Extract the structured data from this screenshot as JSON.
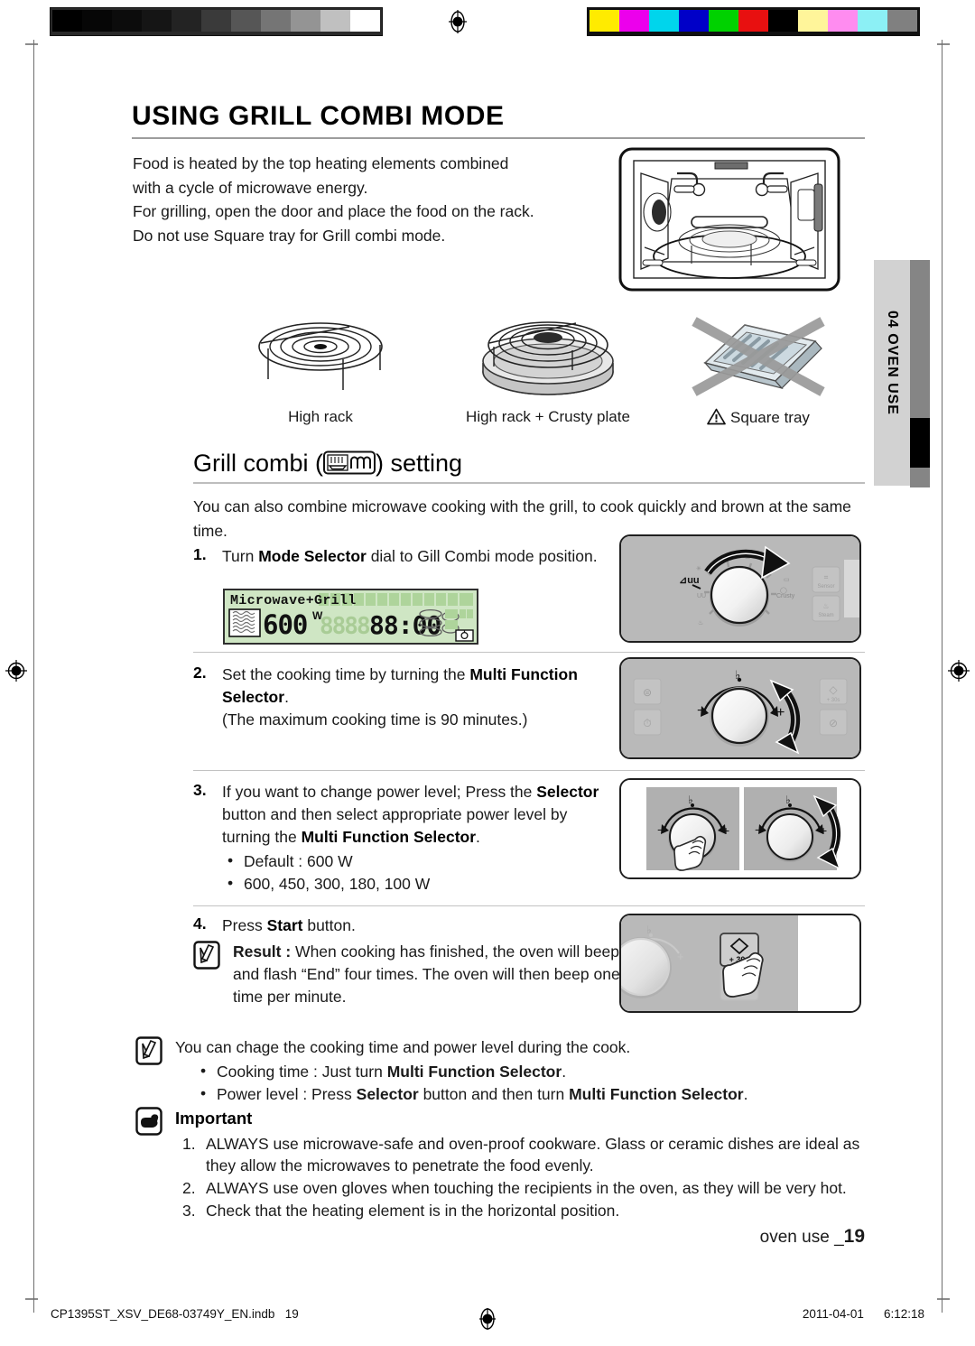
{
  "calibration": {
    "gray_ramp": [
      "#000000",
      "#060606",
      "#0c0c0c",
      "#151515",
      "#232323",
      "#3a3a3a",
      "#565656",
      "#757575",
      "#949494",
      "#c0c0c0",
      "#ffffff"
    ],
    "color_bar": [
      "#ffeb00",
      "#ec00ec",
      "#00d5ec",
      "#0000c8",
      "#00d200",
      "#e81010",
      "#000000",
      "#fff59a",
      "#ff8cf0",
      "#8cf0f5",
      "#808080"
    ],
    "registration_icon": "registration-target-icon"
  },
  "header": {
    "title": "USING GRILL COMBI MODE"
  },
  "intro": {
    "lines": [
      "Food is heated by the top heating elements combined",
      "with a cycle of microwave energy.",
      "For grilling, open the door and place the food on the rack.",
      "Do not use Square tray for Grill combi mode."
    ]
  },
  "accessories": [
    {
      "icon": "high-rack-icon",
      "caption": "High rack",
      "warning": false
    },
    {
      "icon": "high-rack-crusty-plate-icon",
      "caption": "High rack + Crusty plate",
      "warning": false
    },
    {
      "icon": "square-tray-crossed-icon",
      "caption": "Square tray",
      "warning": true
    }
  ],
  "section": {
    "title_before": "Grill combi (",
    "title_icon": "grill-combi-icon",
    "title_after": ") setting",
    "lead": "You can also combine microwave cooking with the grill, to cook quickly and brown at the same time."
  },
  "steps": [
    {
      "number": "1.",
      "text_html": "Turn <b>Mode Selector</b> dial to Gill Combi mode position.",
      "illustration": "mode-selector-dial-turn-illustration"
    },
    {
      "number": "2.",
      "text_html": "Set the cooking time by turning the <b>Multi Function Selector</b>.<br>(The maximum cooking time is 90 minutes.)",
      "illustration": "multi-function-selector-turn-illustration"
    },
    {
      "number": "3.",
      "text_html": "If you want to change power level; Press the <b>Selector</b> button and then select appropriate power level by turning the <b>Multi Function Selector</b>.",
      "bullets": [
        "Default : 600 W",
        "600, 450, 300, 180, 100 W"
      ],
      "illustration": "selector-press-and-turn-illustration"
    },
    {
      "number": "4.",
      "text_html": "Press <b>Start</b> button.",
      "illustration": "start-button-press-illustration"
    }
  ],
  "result_note": {
    "icon": "note-pencil-icon",
    "label": "Result :",
    "text": "When cooking has finished, the oven will beep and flash “End” four times. The oven will then beep one time per minute."
  },
  "lcd": {
    "mode_text": "Microwave+Grill",
    "power_value": "600",
    "power_unit": "W",
    "time_value": "88:00",
    "placeholder_digits": "8888"
  },
  "panel_labels": {
    "start_button": "+ 30s",
    "plus": "+",
    "minus": "-",
    "sensor_cook": "Sensor",
    "steam_cook": "Steam"
  },
  "change_note": {
    "icon": "note-pencil-icon",
    "lead": "You can chage the cooking time and power level during the cook.",
    "bullets_html": [
      "Cooking time : Just turn <b>Multi Function Selector</b>.",
      "Power level : Press <b>Selector</b> button and then turn <b>Multi Function Selector</b>."
    ]
  },
  "important": {
    "icon": "pointing-hand-icon",
    "heading": "Important",
    "items": [
      {
        "num": "1.",
        "text": "ALWAYS use microwave-safe and oven-proof cookware. Glass or ceramic dishes are ideal as they allow the microwaves to penetrate the food evenly."
      },
      {
        "num": "2.",
        "text": "ALWAYS use oven gloves when touching the recipients in the oven, as they will be very hot."
      },
      {
        "num": "3.",
        "text": "Check that the heating element is in the horizontal position."
      }
    ]
  },
  "side_tab": {
    "label": "04 OVEN USE"
  },
  "folio": {
    "text": "oven use _",
    "page": "19"
  },
  "footer": {
    "file": "CP1395ST_XSV_DE68-03749Y_EN.indb",
    "page": "19",
    "date": "2011-04-01",
    "time": "6:12:18"
  }
}
